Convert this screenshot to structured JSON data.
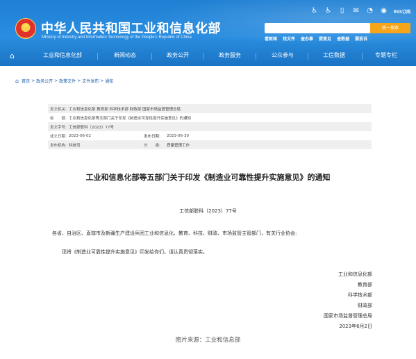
{
  "header": {
    "site_title": "中华人民共和国工业和信息化部",
    "site_subtitle": "Ministry of Industry and Information Technology of the People's Republic of China",
    "rss_label": "RSS订阅",
    "search": {
      "placeholder": "",
      "button_label": "统一搜索"
    },
    "quick_links": [
      "看新闻",
      "找文件",
      "查办事",
      "提意见",
      "查数据",
      "要投诉"
    ]
  },
  "nav": {
    "items": [
      "工业和信息化部",
      "新闻动态",
      "政务公开",
      "政务服务",
      "公众参与",
      "工信数据",
      "专题专栏"
    ]
  },
  "breadcrumb": {
    "items": [
      "首页",
      "政务公开",
      "政策文件",
      "文件发布",
      "通知"
    ],
    "separator": ">"
  },
  "meta": {
    "issuer_label": "发文机关:",
    "issuer_value": "工业和信息化部 教育部 科学技术部 财政部 国家市场监督管理总局",
    "title_label": "标　　题:",
    "title_value": "工业和信息化部等五部门关于印发《制造业可靠性提升实施意见》的通知",
    "docno_label": "发文字号:",
    "docno_value": "工信部联科〔2023〕77号",
    "date_label": "成文日期:",
    "date_value": "2023-06-02",
    "pubdate_label": "发布日期:",
    "pubdate_value": "2023-06-30",
    "org_label": "发布机构:",
    "org_value": "科技司",
    "category_label": "分　　类:",
    "category_value": "质量管理工作"
  },
  "document": {
    "title": "工业和信息化部等五部门关于印发《制造业可靠性提升实施意见》的通知",
    "doc_number": "工信部联科〔2023〕77号",
    "addressee": "各省、自治区、直辖市及新疆生产建设兵团工业和信息化、教育、科技、财政、市场监管主管部门，有关行业协会:",
    "body": "现将《制造业可靠性提升实施意见》印发给你们，请认真贯彻落实。",
    "signers": [
      "工业和信息化部",
      "教育部",
      "科学技术部",
      "财政部",
      "国家市场监督管理总局",
      "2023年6月2日"
    ]
  },
  "caption": "图片来源：工业和信息部"
}
